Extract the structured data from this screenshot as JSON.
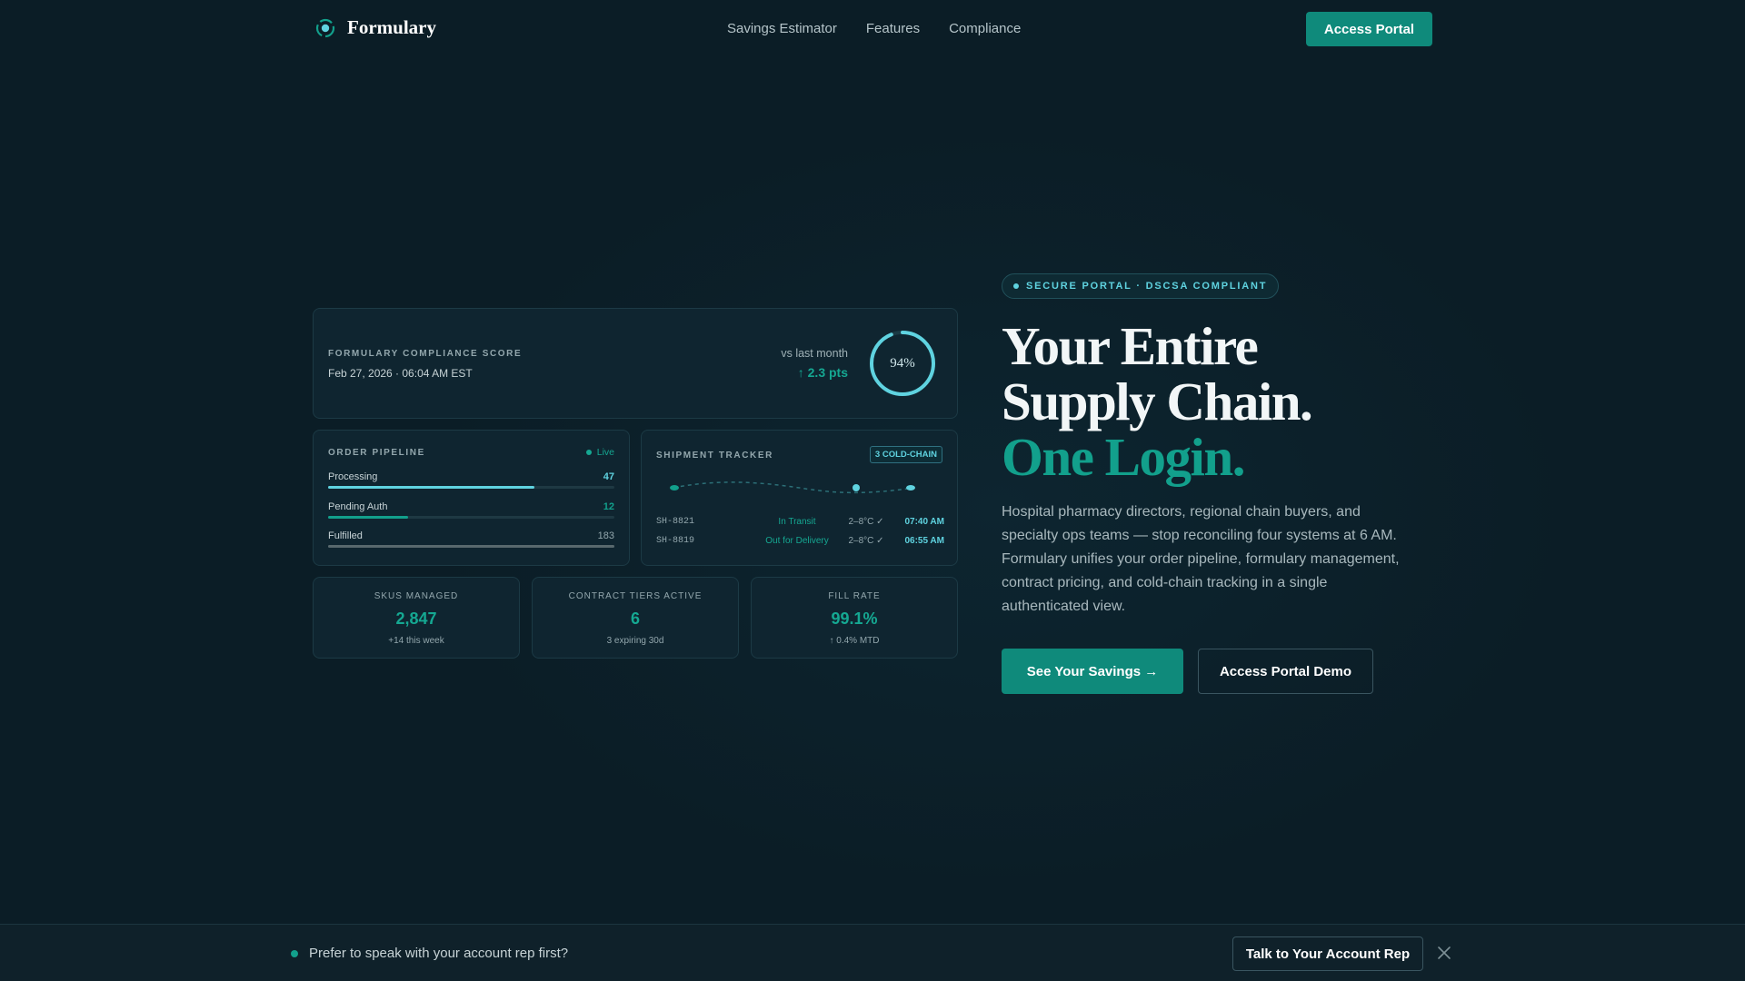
{
  "nav": {
    "brand": "Formulary",
    "links": [
      "Savings Estimator",
      "Features",
      "Compliance"
    ],
    "cta": "Access Portal"
  },
  "score": {
    "label": "FORMULARY COMPLIANCE SCORE",
    "date": "Feb 27, 2026 · 06:04 AM EST",
    "vs_label": "vs last month",
    "delta": "↑ 2.3 pts",
    "value_text": "94%",
    "value": 0.94
  },
  "pipeline": {
    "title": "ORDER PIPELINE",
    "live": "Live",
    "rows": [
      {
        "name": "Processing",
        "count": "47",
        "fill": 0.72,
        "color": "#5fd3e0"
      },
      {
        "name": "Pending Auth",
        "count": "12",
        "fill": 0.28,
        "color": "#12a08c"
      },
      {
        "name": "Fulfilled",
        "count": "183",
        "fill": 1.0,
        "color": "#58686d"
      }
    ]
  },
  "shipments": {
    "title": "SHIPMENT TRACKER",
    "badge": "3 COLD-CHAIN",
    "rows": [
      {
        "id": "SH-8821",
        "status": "In Transit",
        "temp": "2–8°C ✓",
        "time": "07:40 AM"
      },
      {
        "id": "SH-8819",
        "status": "Out for Delivery",
        "temp": "2–8°C ✓",
        "time": "06:55 AM"
      }
    ]
  },
  "stats": [
    {
      "label": "SKUS MANAGED",
      "value": "2,847",
      "sub": "+14 this week"
    },
    {
      "label": "CONTRACT TIERS ACTIVE",
      "value": "6",
      "sub": "3 expiring 30d"
    },
    {
      "label": "FILL RATE",
      "value": "99.1%",
      "sub": "↑ 0.4% MTD"
    }
  ],
  "hero": {
    "pill": "SECURE PORTAL · DSCSA COMPLIANT",
    "h1_line1": "Your Entire",
    "h1_line2": "Supply Chain.",
    "h1_accent": "One Login.",
    "paragraph": "Hospital pharmacy directors, regional chain buyers, and specialty ops teams — stop reconciling four systems at 6 AM. Formulary unifies your order pipeline, formulary management, contract pricing, and cold-chain tracking in a single authenticated view.",
    "primary_cta": "See Your Savings →",
    "secondary_cta": "Access Portal Demo"
  },
  "bottom_bar": {
    "text": "Prefer to speak with your account rep first?",
    "cta": "Talk to Your Account Rep"
  },
  "colors": {
    "accent": "#12a08c",
    "cyan": "#5fd3e0",
    "background": "#0b1d26"
  }
}
